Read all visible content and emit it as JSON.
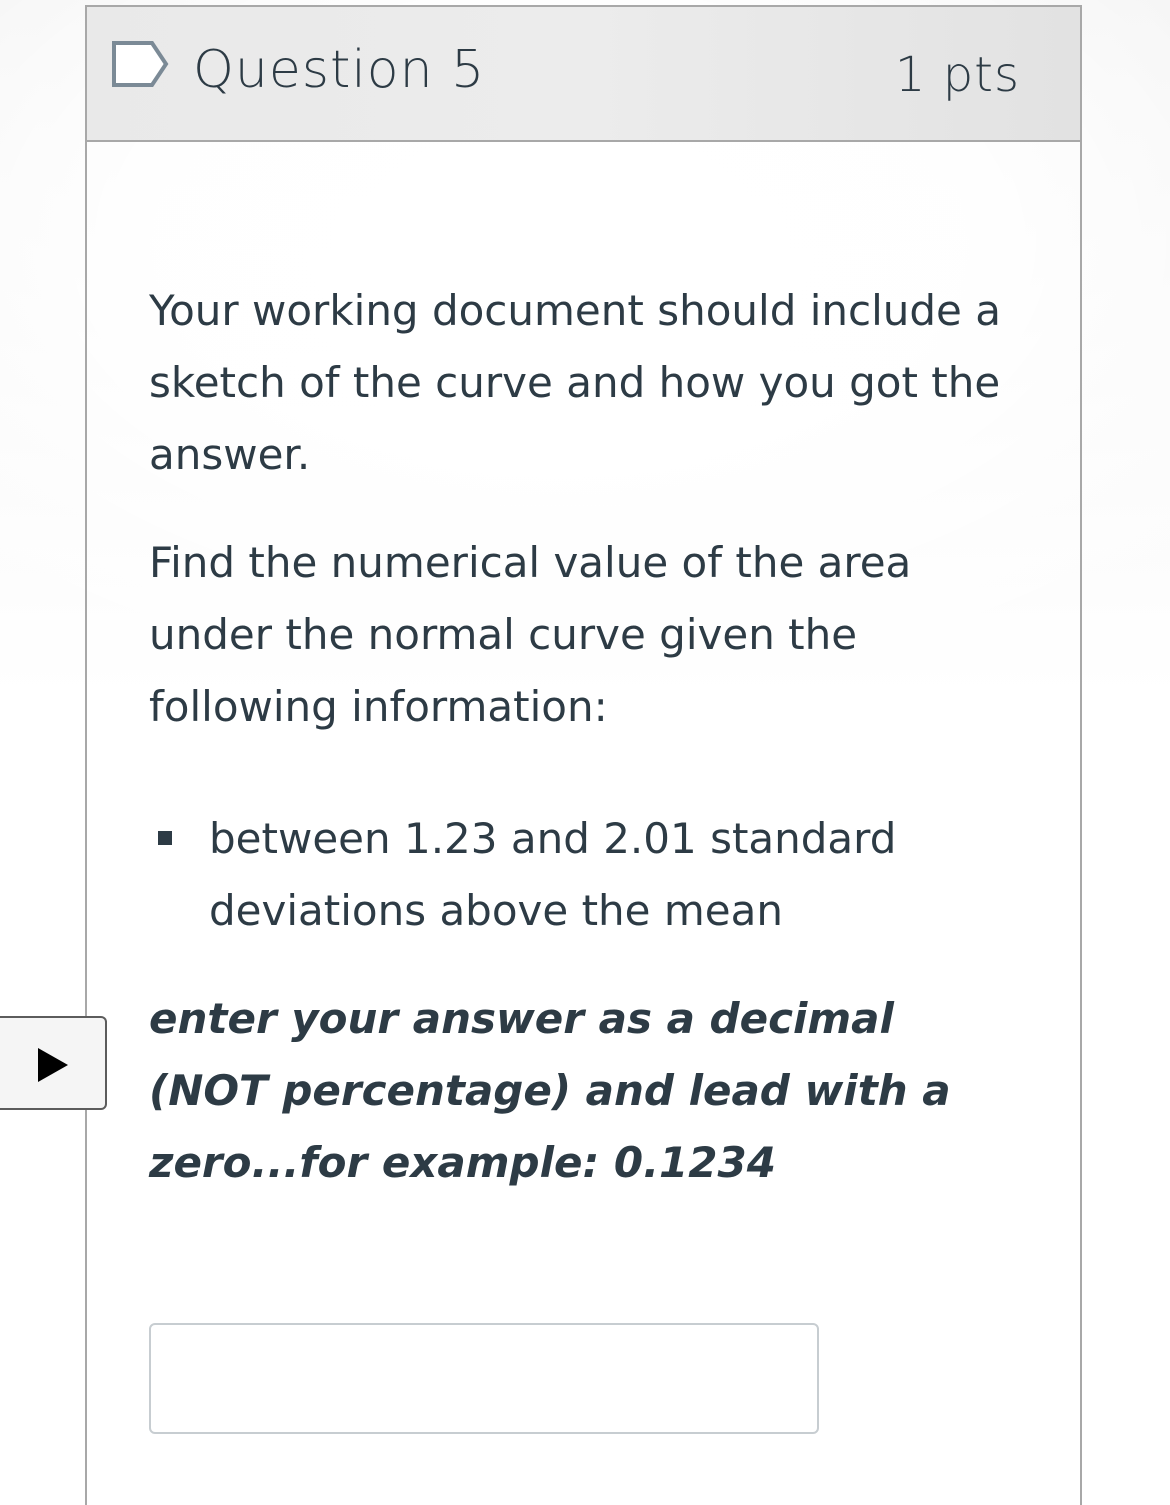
{
  "question": {
    "title": "Question 5",
    "points": "1 pts",
    "flag_icon": "flag-outline-icon",
    "body": {
      "paragraph_1": "Your working document should include a sketch of the curve and how you got the answer.",
      "paragraph_2": "Find the numerical value of the area under the normal curve given the following information:",
      "bullets": [
        "between 1.23 and 2.01 standard deviations above the mean"
      ],
      "instruction": "enter your answer as a decimal (NOT percentage) and lead with a zero...for example:  0.1234"
    },
    "answer_input": {
      "value": "",
      "placeholder": ""
    }
  },
  "side_toggle": {
    "icon": "play-icon"
  },
  "colors": {
    "text": "#2d3b45",
    "border": "#a8a8a8",
    "header_bg": "#e9e9e9",
    "input_border": "#c7cdd1"
  }
}
